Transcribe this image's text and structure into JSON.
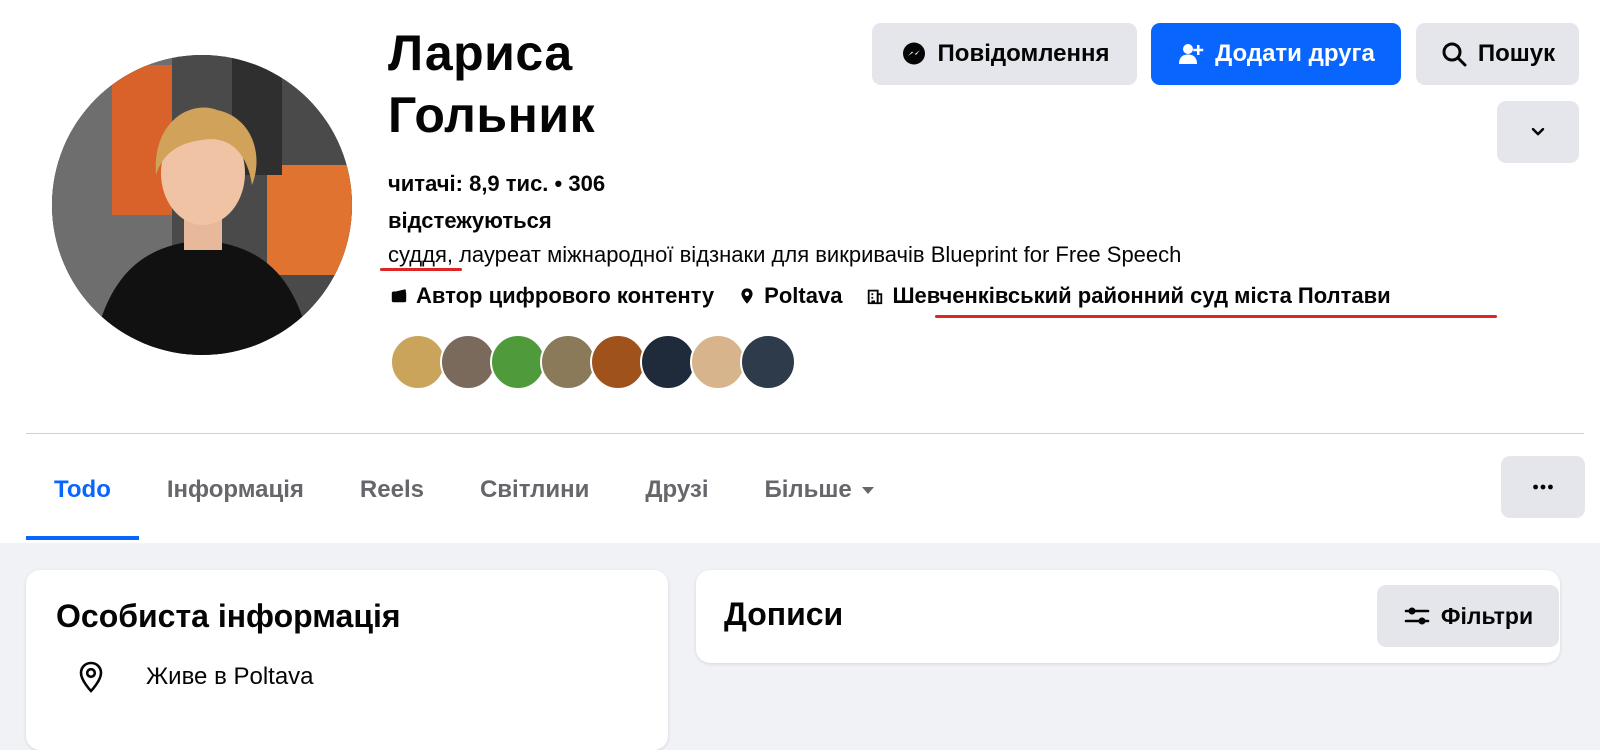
{
  "profile": {
    "name_line1": "Лариса",
    "name_line2": "Гольник",
    "stats_line1": "читачі: 8,9 тис. • 306",
    "stats_line2": "відстежуються",
    "bio_highlight": "суддя",
    "bio_rest": ", лауреат міжнародної відзнаки для викривачів Blueprint for Free Speech",
    "details": {
      "category": "Автор цифрового контенту",
      "location": "Poltava",
      "work": "Шевченківський районний суд міста Полтави"
    },
    "friend_avatar_colors": [
      "#c9a45a",
      "#7a6a5c",
      "#4f9a3a",
      "#8a7a5a",
      "#a0521d",
      "#1f2b3a",
      "#d8b48c",
      "#2e3b4a"
    ]
  },
  "actions": {
    "message": "Повідомлення",
    "add_friend": "Додати друга",
    "search": "Пошук"
  },
  "tabs": [
    "Todo",
    "Інформація",
    "Reels",
    "Світлини",
    "Друзі",
    "Більше"
  ],
  "about_card": {
    "title": "Особиста інформація",
    "lives_in": "Живе в Poltava"
  },
  "posts_card": {
    "title": "Дописи",
    "filters": "Фільтри"
  },
  "colors": {
    "accent": "#0866ff",
    "annotation": "#e02424",
    "button_grey": "#e4e6eb"
  }
}
